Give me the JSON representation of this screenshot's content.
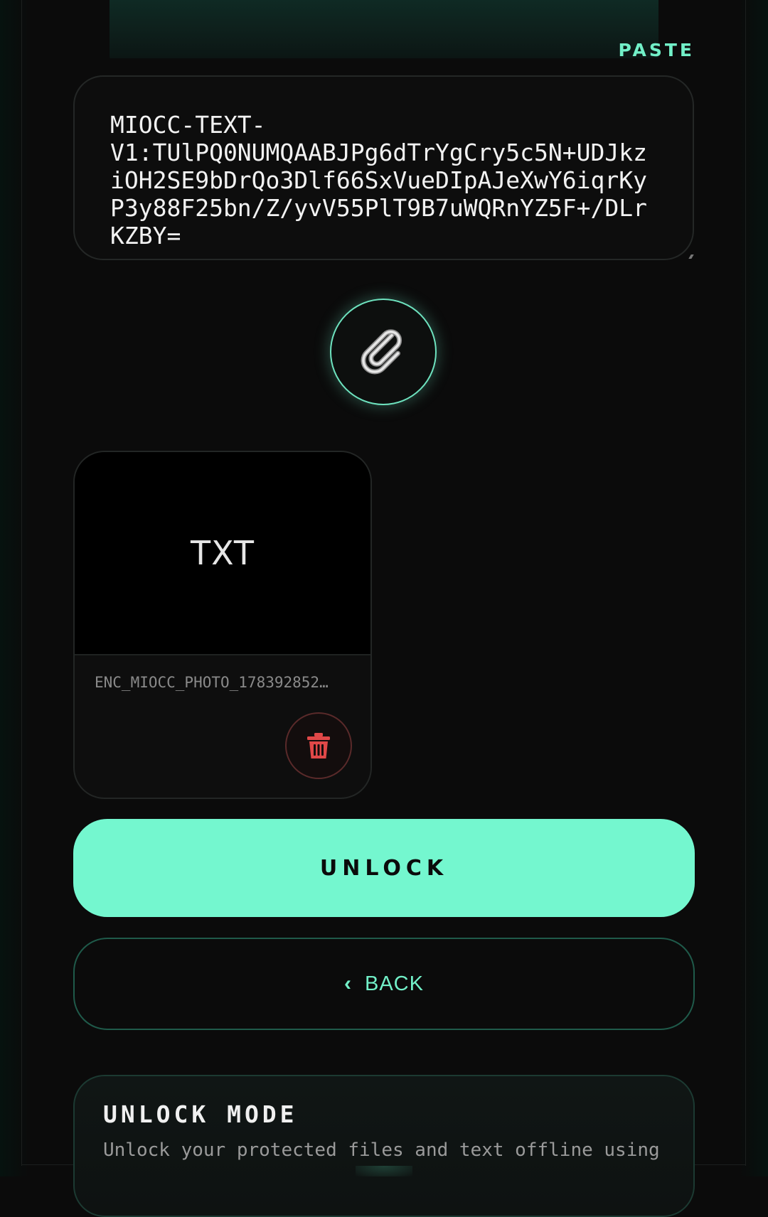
{
  "paste": {
    "label": "PASTE"
  },
  "cipher_input": {
    "value": "MIOCC-TEXT-\nV1:TUlPQ0NUMQAABJPg6dTrYgCry5c5N+UDJkziOH2SE9bDrQo3Dlf66SxVueDIpAJeXwY6iqrKyP3y88F25bn/Z/yvV55PlT9B7uWQRnYZ5F+/DLrKZBY="
  },
  "attach": {
    "icon": "paperclip-icon"
  },
  "file_card": {
    "type_label": "TXT",
    "file_name": "ENC_MIOCC_PHOTO_178392852…",
    "delete_icon": "trash-icon"
  },
  "unlock": {
    "label": "UNLOCK"
  },
  "back": {
    "chevron": "‹",
    "label": "BACK"
  },
  "info": {
    "title": "UNLOCK MODE",
    "body": "Unlock your protected files and text offline using"
  },
  "colors": {
    "accent": "#74f7cf",
    "background": "#0b0b0b",
    "danger": "#e04848"
  }
}
